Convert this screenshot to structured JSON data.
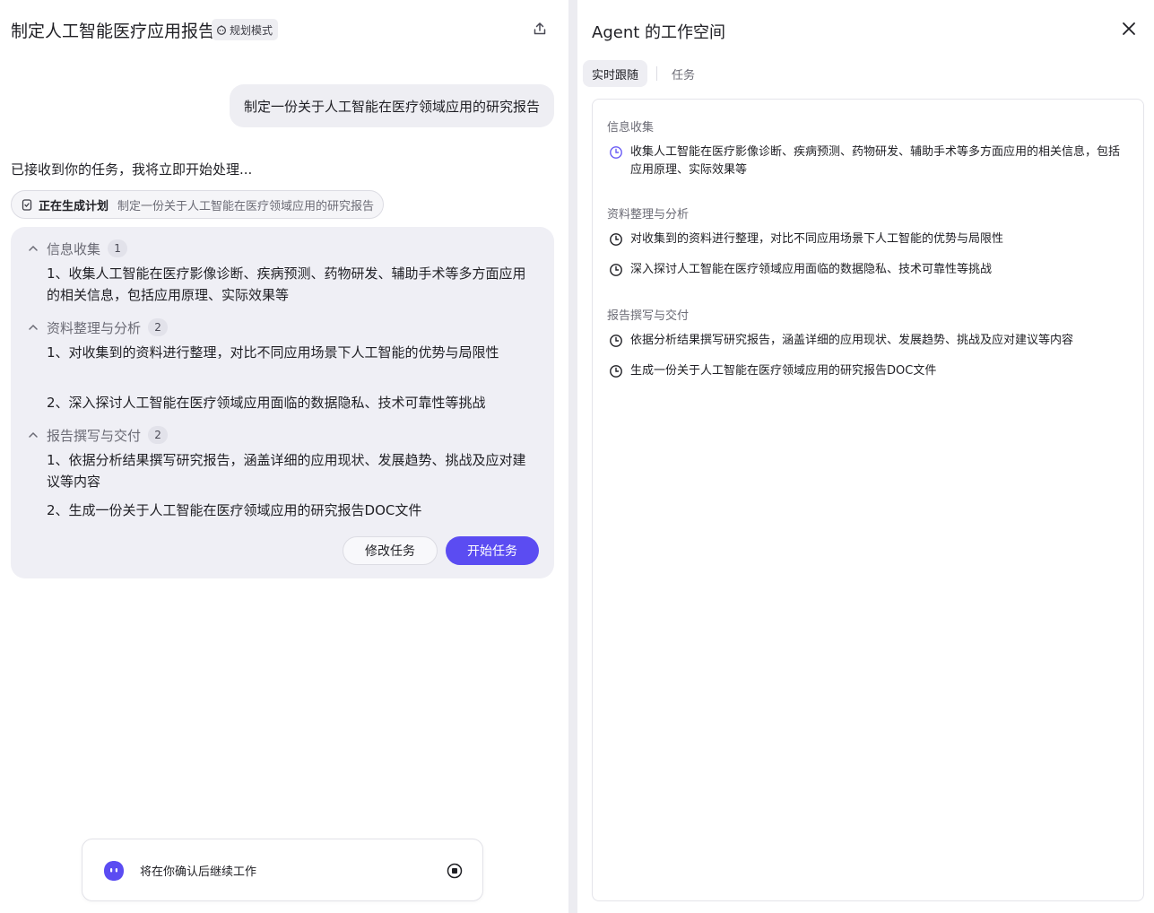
{
  "header": {
    "title": "制定人工智能医疗应用报告",
    "mode_label": "规划模式"
  },
  "chat": {
    "user_message": "制定一份关于人工智能在医疗领域应用的研究报告",
    "ack": "已接收到你的任务，我将立即开始处理...",
    "plan_pill": {
      "label": "正在生成计划",
      "subtitle": "制定一份关于人工智能在医疗领域应用的研究报告"
    },
    "plan": {
      "sections": [
        {
          "title": "信息收集",
          "count": "1",
          "items": [
            "1、收集人工智能在医疗影像诊断、疾病预测、药物研发、辅助手术等多方面应用的相关信息，包括应用原理、实际效果等"
          ]
        },
        {
          "title": "资料整理与分析",
          "count": "2",
          "items": [
            "1、对收集到的资料进行整理，对比不同应用场景下人工智能的优势与局限性",
            "2、深入探讨人工智能在医疗领域应用面临的数据隐私、技术可靠性等挑战"
          ]
        },
        {
          "title": "报告撰写与交付",
          "count": "2",
          "items": [
            "1、依据分析结果撰写研究报告，涵盖详细的应用现状、发展趋势、挑战及应对建议等内容",
            "2、生成一份关于人工智能在医疗领域应用的研究报告DOC文件"
          ]
        }
      ],
      "modify_label": "修改任务",
      "start_label": "开始任务"
    },
    "status": "将在你确认后继续工作"
  },
  "workspace": {
    "title": "Agent 的工作空间",
    "tabs": [
      "实时跟随",
      "任务"
    ],
    "sections": [
      {
        "title": "信息收集",
        "items": [
          "收集人工智能在医疗影像诊断、疾病预测、药物研发、辅助手术等多方面应用的相关信息，包括应用原理、实际效果等"
        ]
      },
      {
        "title": "资料整理与分析",
        "items": [
          "对收集到的资料进行整理，对比不同应用场景下人工智能的优势与局限性",
          "深入探讨人工智能在医疗领域应用面临的数据隐私、技术可靠性等挑战"
        ]
      },
      {
        "title": "报告撰写与交付",
        "items": [
          "依据分析结果撰写研究报告，涵盖详细的应用现状、发展趋势、挑战及应对建议等内容",
          "生成一份关于人工智能在医疗领域应用的研究报告DOC文件"
        ]
      }
    ]
  },
  "colors": {
    "accent": "#5b4cf2",
    "active_clock": "#6a5cf5"
  }
}
